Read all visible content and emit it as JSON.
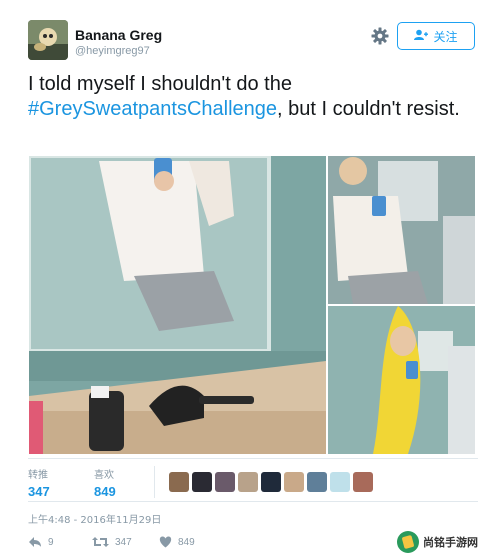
{
  "user": {
    "display_name": "Banana Greg",
    "handle": "@heyimgreg97"
  },
  "follow_button": {
    "label": "关注",
    "icon": "add-user-icon"
  },
  "settings_icon": "gear-icon",
  "tweet": {
    "text_before": "I told myself I shouldn't do the ",
    "hashtag": "#GreySweatpantsChallenge",
    "text_after": ", but I couldn't resist."
  },
  "media": {
    "count": 3,
    "photos": [
      "mirror-selfie-wide",
      "mirror-selfie-closeup",
      "banana-costume-selfie"
    ]
  },
  "stats": {
    "retweets_label": "转推",
    "retweets_value": "347",
    "likes_label": "喜欢",
    "likes_value": "849",
    "liker_avatar_count": 9
  },
  "timestamp": "上午4:48 - 2016年11月29日",
  "actions": {
    "reply_count": "9",
    "retweet_count": "347",
    "like_count": "849"
  },
  "watermark": {
    "text": "尚铭手游网"
  },
  "colors": {
    "accent": "#1da1f2",
    "link": "#1b95e0",
    "muted": "#8899a6",
    "border": "#e1e8ed"
  }
}
